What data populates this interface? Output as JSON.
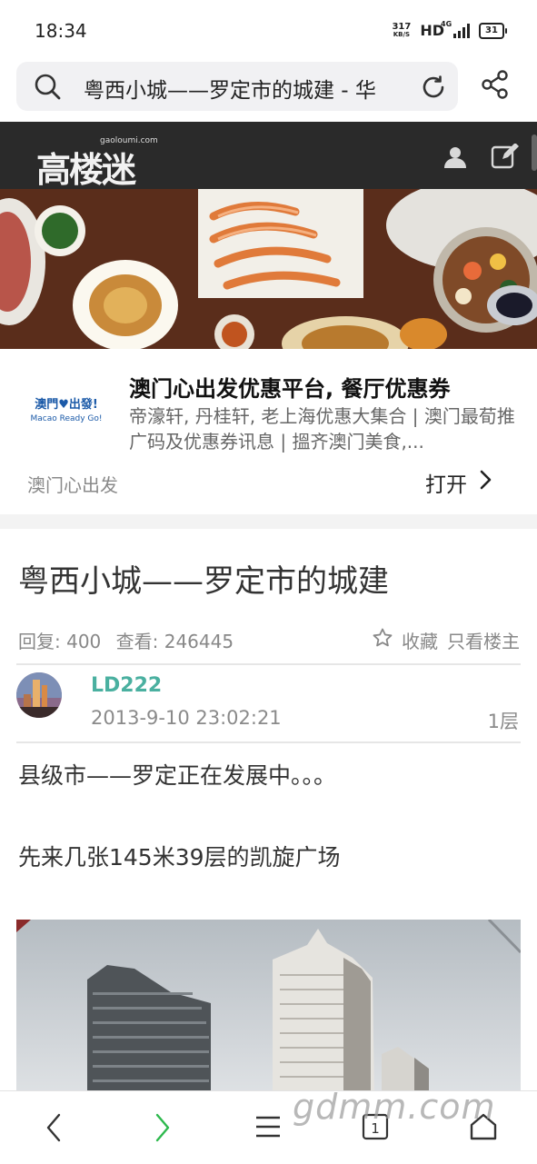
{
  "status": {
    "time": "18:34",
    "net_speed": "317",
    "net_unit": "KB/S",
    "hd": "HD",
    "network": "4G",
    "battery": "31"
  },
  "browser": {
    "url_title": "粤西小城——罗定市的城建 - 华"
  },
  "site": {
    "logo_text": "高楼迷",
    "logo_sub": "gaoloumi.com"
  },
  "ad": {
    "logo_line1": "澳門♥出發!",
    "logo_line2": "Macao Ready Go!",
    "title": "澳门心出发优惠平台, 餐厅优惠券",
    "description": "帝濠轩, 丹桂轩, 老上海优惠大集合 | 澳门最荀推广码及优惠券讯息 | 搵齐澳门美食,...",
    "brand": "澳门心出发",
    "open_label": "打开"
  },
  "post": {
    "title": "粤西小城——罗定市的城建",
    "replies": "回复: 400",
    "views": "查看: 246445",
    "favorite_label": "收藏",
    "only_author_label": "只看楼主",
    "author": "LD222",
    "time": "2013-9-10 23:02:21",
    "floor": "1层",
    "paragraph1": "县级市——罗定正在发展中。。。",
    "paragraph2": "先来几张145米39层的凯旋广场"
  },
  "bottom_nav": {
    "tabs_count": "1",
    "watermark": "gdmm.com"
  },
  "colors": {
    "author": "#4ab0a0",
    "forward_arrow": "#2db94d",
    "header_bg": "#2a2a2a"
  }
}
